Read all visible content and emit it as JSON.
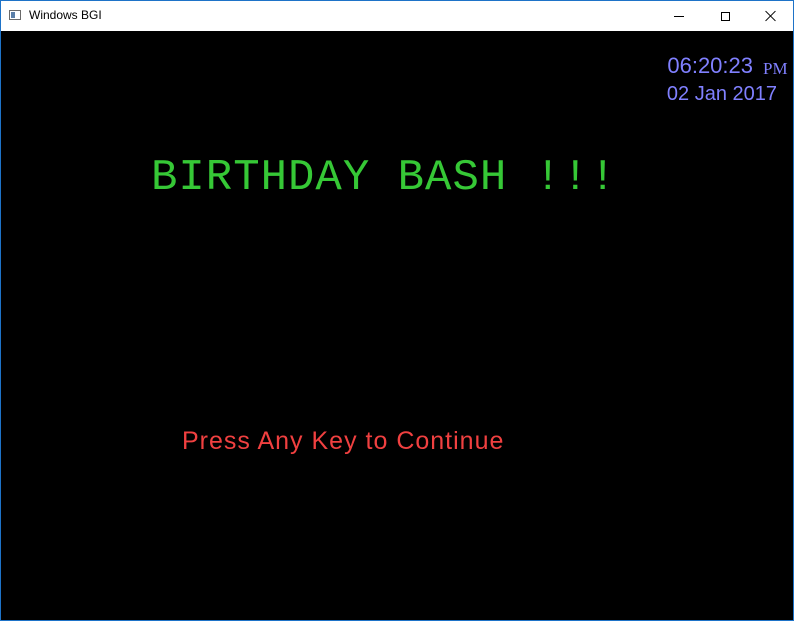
{
  "window": {
    "title": "Windows BGI",
    "icon": "bgi-app-icon",
    "controls": {
      "minimize": "minimize-icon",
      "maximize": "maximize-icon",
      "close": "close-icon"
    }
  },
  "screen": {
    "clock": {
      "time": "06:20:23",
      "ampm": "PM",
      "date": "02 Jan 2017"
    },
    "headline": "BIRTHDAY BASH !!!",
    "prompt": "Press Any Key to Continue"
  },
  "colors": {
    "background": "#000000",
    "clock": "#8080ff",
    "headline": "#36c836",
    "prompt": "#f04040"
  }
}
